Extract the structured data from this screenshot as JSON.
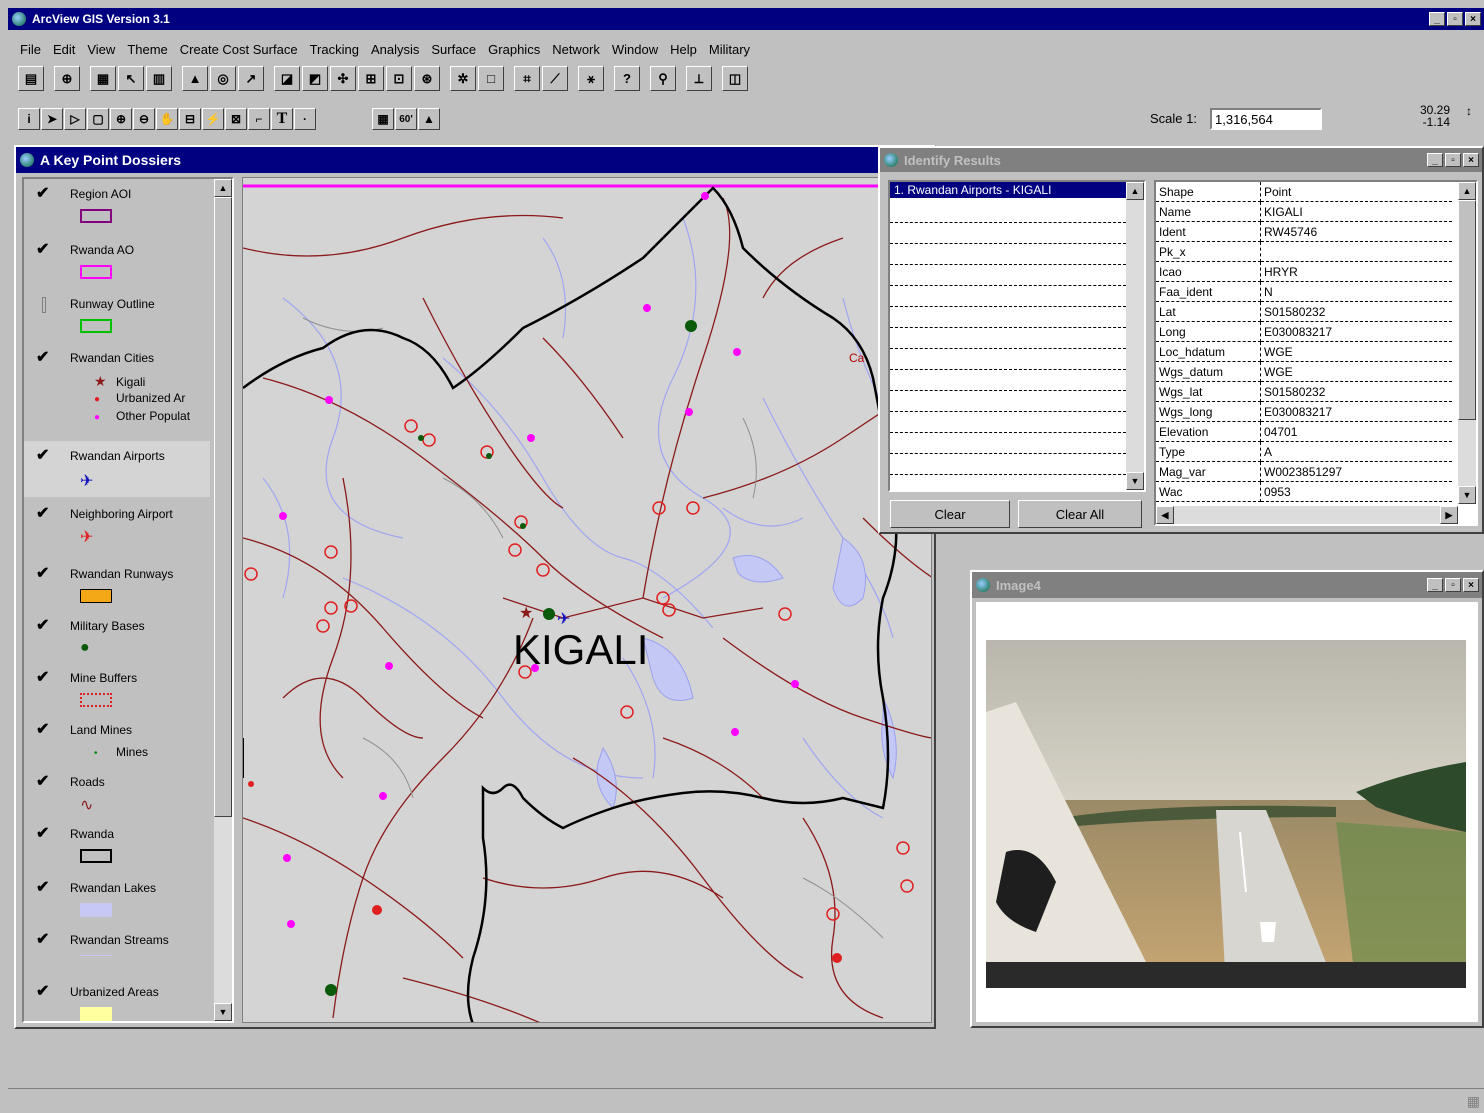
{
  "app": {
    "title": "ArcView GIS Version 3.1",
    "menus": [
      "File",
      "Edit",
      "View",
      "Theme",
      "Create Cost Surface",
      "Tracking",
      "Analysis",
      "Surface",
      "Graphics",
      "Network",
      "Window",
      "Help",
      "Military"
    ]
  },
  "toolbar": {
    "scale_label": "Scale 1:",
    "scale_value": "1,316,564",
    "coord_x": "30.29",
    "coord_y": "-1.14"
  },
  "view_window": {
    "title": "A Key Point Dossiers",
    "map_label": "KIGALI"
  },
  "legend": [
    {
      "label": "Region AOI",
      "checked": true
    },
    {
      "label": "Rwanda AO",
      "checked": true
    },
    {
      "label": "Runway Outline",
      "checked": false
    },
    {
      "label": "Rwandan Cities",
      "checked": true,
      "subs": [
        "Kigali",
        "Urbanized Ar",
        "Other Populat"
      ]
    },
    {
      "label": "Rwandan Airports",
      "checked": true
    },
    {
      "label": "Neighboring Airport",
      "checked": true
    },
    {
      "label": "Rwandan Runways",
      "checked": true
    },
    {
      "label": "Military Bases",
      "checked": true
    },
    {
      "label": "Mine Buffers",
      "checked": true
    },
    {
      "label": "Land Mines",
      "checked": true,
      "subs": [
        "Mines"
      ]
    },
    {
      "label": "Roads",
      "checked": true
    },
    {
      "label": "Rwanda",
      "checked": true
    },
    {
      "label": "Rwandan Lakes",
      "checked": true
    },
    {
      "label": "Rwandan Streams",
      "checked": true
    },
    {
      "label": "Urbanized Areas",
      "checked": true
    }
  ],
  "identify": {
    "title": "Identify Results",
    "result_item": "1. Rwandan Airports - KIGALI",
    "clear_label": "Clear",
    "clear_all_label": "Clear All",
    "fields": [
      [
        "Shape",
        "Point"
      ],
      [
        "Name",
        "KIGALI"
      ],
      [
        "Ident",
        "RW45746"
      ],
      [
        "Pk_x",
        ""
      ],
      [
        "Icao",
        "HRYR"
      ],
      [
        "Faa_ident",
        "N"
      ],
      [
        "Lat",
        "S01580232"
      ],
      [
        "Long",
        "E030083217"
      ],
      [
        "Loc_hdatum",
        "WGE"
      ],
      [
        "Wgs_datum",
        "WGE"
      ],
      [
        "Wgs_lat",
        "S01580232"
      ],
      [
        "Wgs_long",
        "E030083217"
      ],
      [
        "Elevation",
        "04701"
      ],
      [
        "Type",
        "A"
      ],
      [
        "Mag_var",
        "W0023851297"
      ],
      [
        "Wac",
        "0953"
      ]
    ]
  },
  "image_window": {
    "title": "Image4"
  },
  "colors": {
    "titlebar_active": "#000080",
    "map_bg": "#d4d4d4",
    "road": "#8b1a1a",
    "stream": "#9aa0f0",
    "border": "#000000",
    "city": "#ff00ff"
  }
}
